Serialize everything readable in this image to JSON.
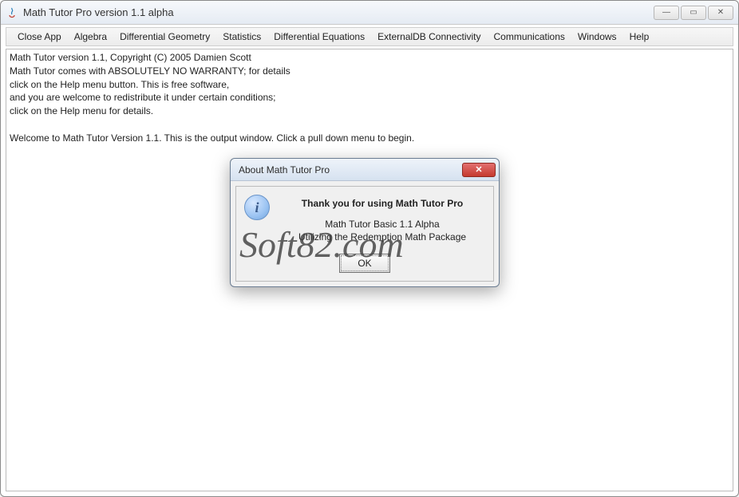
{
  "window": {
    "title": "Math Tutor Pro version 1.1 alpha",
    "controls": {
      "minimize": "—",
      "maximize": "▭",
      "close": "✕"
    }
  },
  "menubar": {
    "items": [
      "Close App",
      "Algebra",
      "Differential Geometry",
      "Statistics",
      "Differential Equations",
      "ExternalDB Connectivity",
      "Communications",
      "Windows",
      "Help"
    ]
  },
  "output": {
    "lines": [
      "Math Tutor version 1.1, Copyright (C) 2005 Damien Scott",
      "Math Tutor comes with ABSOLUTELY NO WARRANTY; for details",
      "click on the Help menu button.  This is free software,",
      "and you are welcome to redistribute it under certain conditions;",
      "click on the Help menu for details.",
      "",
      "Welcome to Math Tutor Version 1.1.  This is the output window. Click a pull down menu to begin."
    ]
  },
  "dialog": {
    "title": "About Math Tutor Pro",
    "close_glyph": "✕",
    "info_glyph": "i",
    "heading": "Thank you for using Math Tutor Pro",
    "line1": "Math Tutor Basic 1.1 Alpha",
    "line2": "Utilizing the Redemption Math Package",
    "ok_label": "OK"
  },
  "watermark": "Soft82.com"
}
